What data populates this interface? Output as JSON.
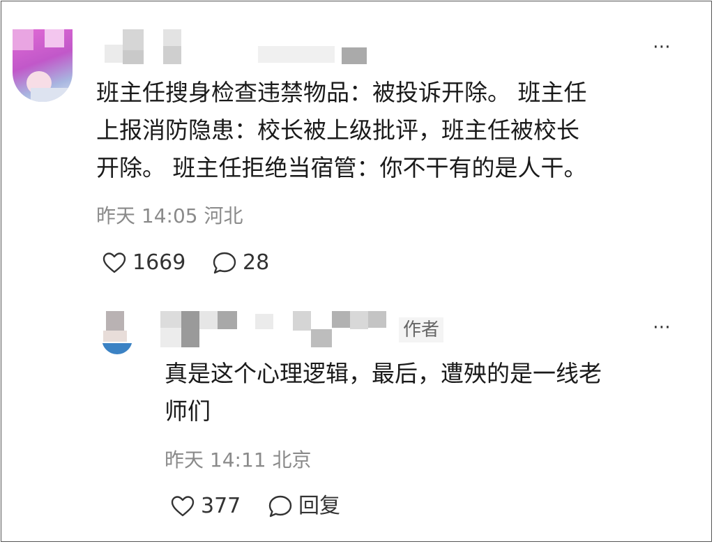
{
  "main_comment": {
    "text": "班主任搜身检查违禁物品：被投诉开除。 班主任\n上报消防隐患：校长被上级批评，班主任被校长\n开除。 班主任拒绝当宿管：你不干有的是人干。",
    "time": "昨天 14:05",
    "location": "河北",
    "likes": "1669",
    "comments": "28",
    "more_icon": "more-horizontal-icon",
    "like_icon": "heart-outline-icon",
    "comment_icon": "speech-bubble-icon"
  },
  "reply_comment": {
    "author_tag": "作者",
    "text": "真是这个心理逻辑，最后，遭殃的是一线老\n师们",
    "time": "昨天 14:11",
    "location": "北京",
    "likes": "377",
    "reply_label": "回复",
    "more_icon": "more-horizontal-icon",
    "like_icon": "heart-outline-icon",
    "comment_icon": "speech-bubble-icon"
  },
  "colors": {
    "text_primary": "#1a1a1a",
    "text_meta": "#8a8a8a",
    "background": "#ffffff"
  }
}
